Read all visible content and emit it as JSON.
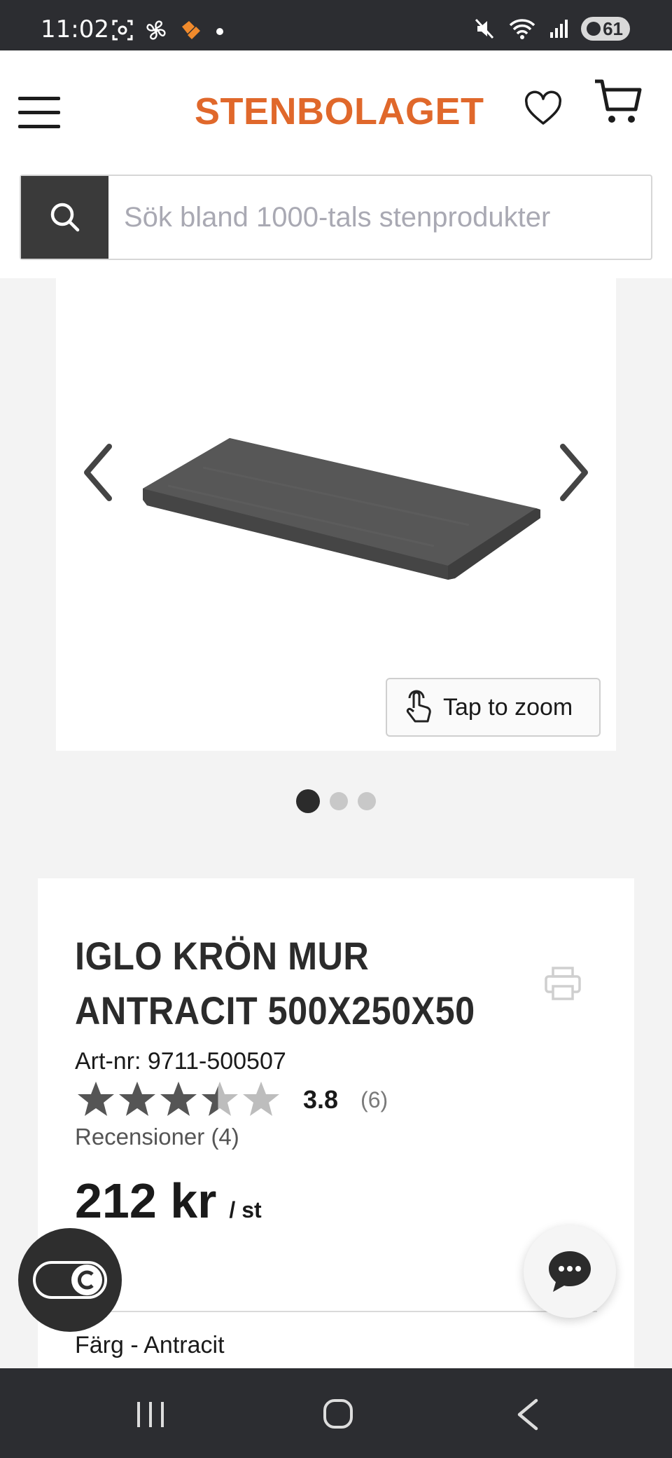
{
  "status_bar": {
    "time": "11:02",
    "battery": "61",
    "icons": [
      "screenshot-icon",
      "fan-icon",
      "app-icon",
      "dot-icon",
      "mute-icon",
      "wifi-icon",
      "signal-icon"
    ]
  },
  "header": {
    "logo": "STENBOLAGET",
    "icons": [
      "menu-icon",
      "heart-icon",
      "cart-icon"
    ]
  },
  "search": {
    "placeholder": "Sök bland 1000-tals stenprodukter"
  },
  "gallery": {
    "zoom_label": "Tap to zoom",
    "slide_count": 3,
    "active_slide": 1
  },
  "product": {
    "title": "IGLO KRÖN MUR ANTRACIT 500X250X50",
    "article": "Art-nr: 9711-500507",
    "rating_value": "3.8",
    "rating_count": "(6)",
    "rating_fraction": 0.76,
    "reviews_link": "Recensioner (4)",
    "price": "212 kr",
    "unit": "/ st",
    "color_label": "Färg - Antracit"
  },
  "colors": {
    "brand": "#e0682b",
    "dark": "#2c2d31",
    "search_button": "#3a3a3a"
  }
}
